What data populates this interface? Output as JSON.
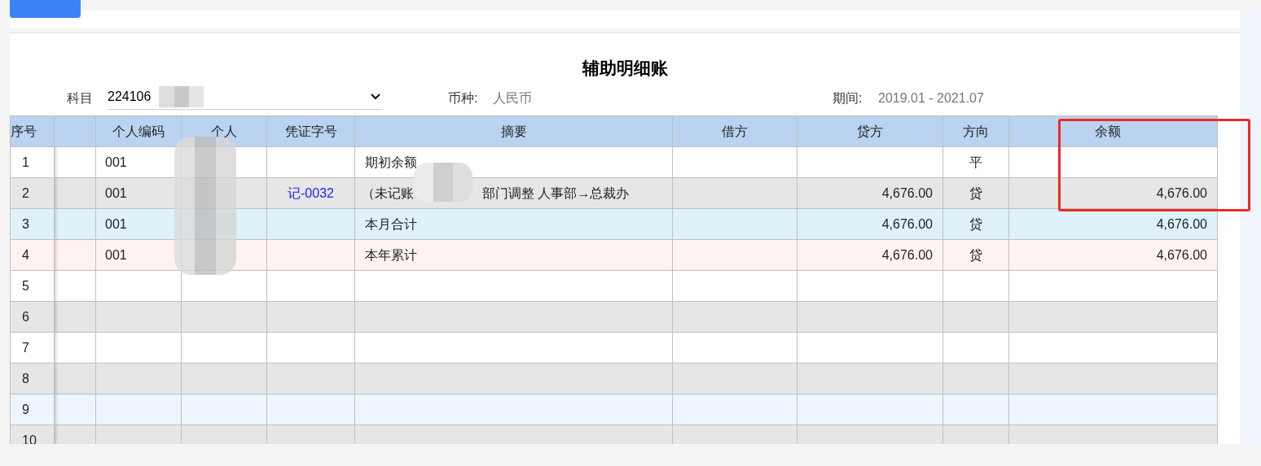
{
  "title": "辅助明细账",
  "filter": {
    "subject_label": "科目",
    "subject_value": "224106",
    "currency_label": "币种:",
    "currency_value": "人民币",
    "period_label": "期间:",
    "period_value": "2019.01 - 2021.07"
  },
  "table": {
    "columns": [
      "序号",
      "",
      "个人编码",
      "个人",
      "凭证字号",
      "摘要",
      "借方",
      "贷方",
      "方向",
      "余额"
    ],
    "rows": [
      {
        "kind": "plain",
        "cells": [
          "1",
          "",
          "001",
          "",
          "",
          "期初余额",
          "",
          "",
          "平",
          ""
        ]
      },
      {
        "kind": "striped",
        "cells": [
          "2",
          "",
          "001",
          "",
          "记-0032",
          "",
          "",
          "4,676.00",
          "贷",
          "4,676.00"
        ],
        "summary_parts": [
          "（未记账",
          "部门调整 人事部→总裁办"
        ]
      },
      {
        "kind": "month_total",
        "cells": [
          "3",
          "",
          "001",
          "",
          "",
          "本月合计",
          "",
          "4,676.00",
          "贷",
          "4,676.00"
        ]
      },
      {
        "kind": "year_total",
        "cells": [
          "4",
          "",
          "001",
          "",
          "",
          "本年累计",
          "",
          "4,676.00",
          "贷",
          "4,676.00"
        ]
      },
      {
        "kind": "plain",
        "cells": [
          "5",
          "",
          "",
          "",
          "",
          "",
          "",
          "",
          "",
          ""
        ]
      },
      {
        "kind": "striped",
        "cells": [
          "6",
          "",
          "",
          "",
          "",
          "",
          "",
          "",
          "",
          ""
        ]
      },
      {
        "kind": "plain",
        "cells": [
          "7",
          "",
          "",
          "",
          "",
          "",
          "",
          "",
          "",
          ""
        ]
      },
      {
        "kind": "striped",
        "cells": [
          "8",
          "",
          "",
          "",
          "",
          "",
          "",
          "",
          "",
          ""
        ]
      },
      {
        "kind": "hover",
        "cells": [
          "9",
          "",
          "",
          "",
          "",
          "",
          "",
          "",
          "",
          ""
        ]
      },
      {
        "kind": "striped",
        "cells": [
          "10",
          "",
          "",
          "",
          "",
          "",
          "",
          "",
          "",
          ""
        ]
      }
    ]
  }
}
